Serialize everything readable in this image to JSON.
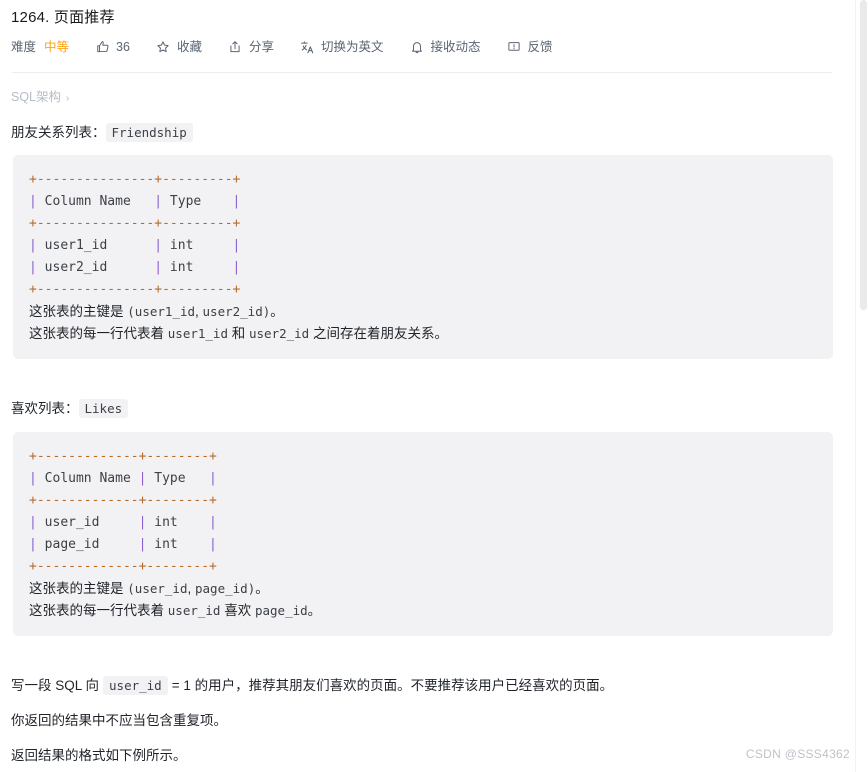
{
  "header": {
    "title": "1264. 页面推荐",
    "meta": {
      "difficulty_label": "难度",
      "difficulty_value": "中等",
      "like_count": "36",
      "favorite_label": "收藏",
      "share_label": "分享",
      "translate_label": "切换为英文",
      "subscribe_label": "接收动态",
      "feedback_label": "反馈"
    }
  },
  "breadcrumb": {
    "label": "SQL架构",
    "chevron": "›"
  },
  "content": {
    "table1_caption": "朋友关系列表：",
    "table1_name": "Friendship",
    "table1_ascii": "+---------------+---------+\n| Column Name   | Type    |\n+---------------+---------+\n| user1_id      | int     |\n| user2_id      | int     |\n+---------------+---------+",
    "table1_note1": "这张表的主键是 (user1_id, user2_id)。",
    "table1_note2": "这张表的每一行代表着 user1_id 和 user2_id 之间存在着朋友关系。",
    "table2_caption": "喜欢列表：",
    "table2_name": "Likes",
    "table2_ascii": "+-------------+--------+\n| Column Name | Type   |\n+-------------+--------+\n| user_id     | int    |\n| page_id     | int    |\n+-------------+--------+",
    "table2_note1": "这张表的主键是 (user_id, page_id)。",
    "table2_note2": "这张表的每一行代表着 user_id 喜欢 page_id。",
    "prompt_part1": "写一段 SQL 向",
    "prompt_code": "user_id",
    "prompt_part2": "= 1 的用户，推荐其朋友们喜欢的页面。不要推荐该用户已经喜欢的页面。",
    "prompt_line2": "你返回的结果中不应当包含重复项。",
    "prompt_line3": "返回结果的格式如下例所示。"
  },
  "watermark": "CSDN @SSS4362",
  "colors": {
    "difficulty": "#ffa116",
    "code_bg": "#f2f2f4",
    "rule": "#b96a2b",
    "pipe": "#8a5fd0",
    "text": "#1f2329",
    "muted": "#5b6573",
    "breadcrumb": "#b6bcc6",
    "watermark": "#bfc3c9"
  }
}
